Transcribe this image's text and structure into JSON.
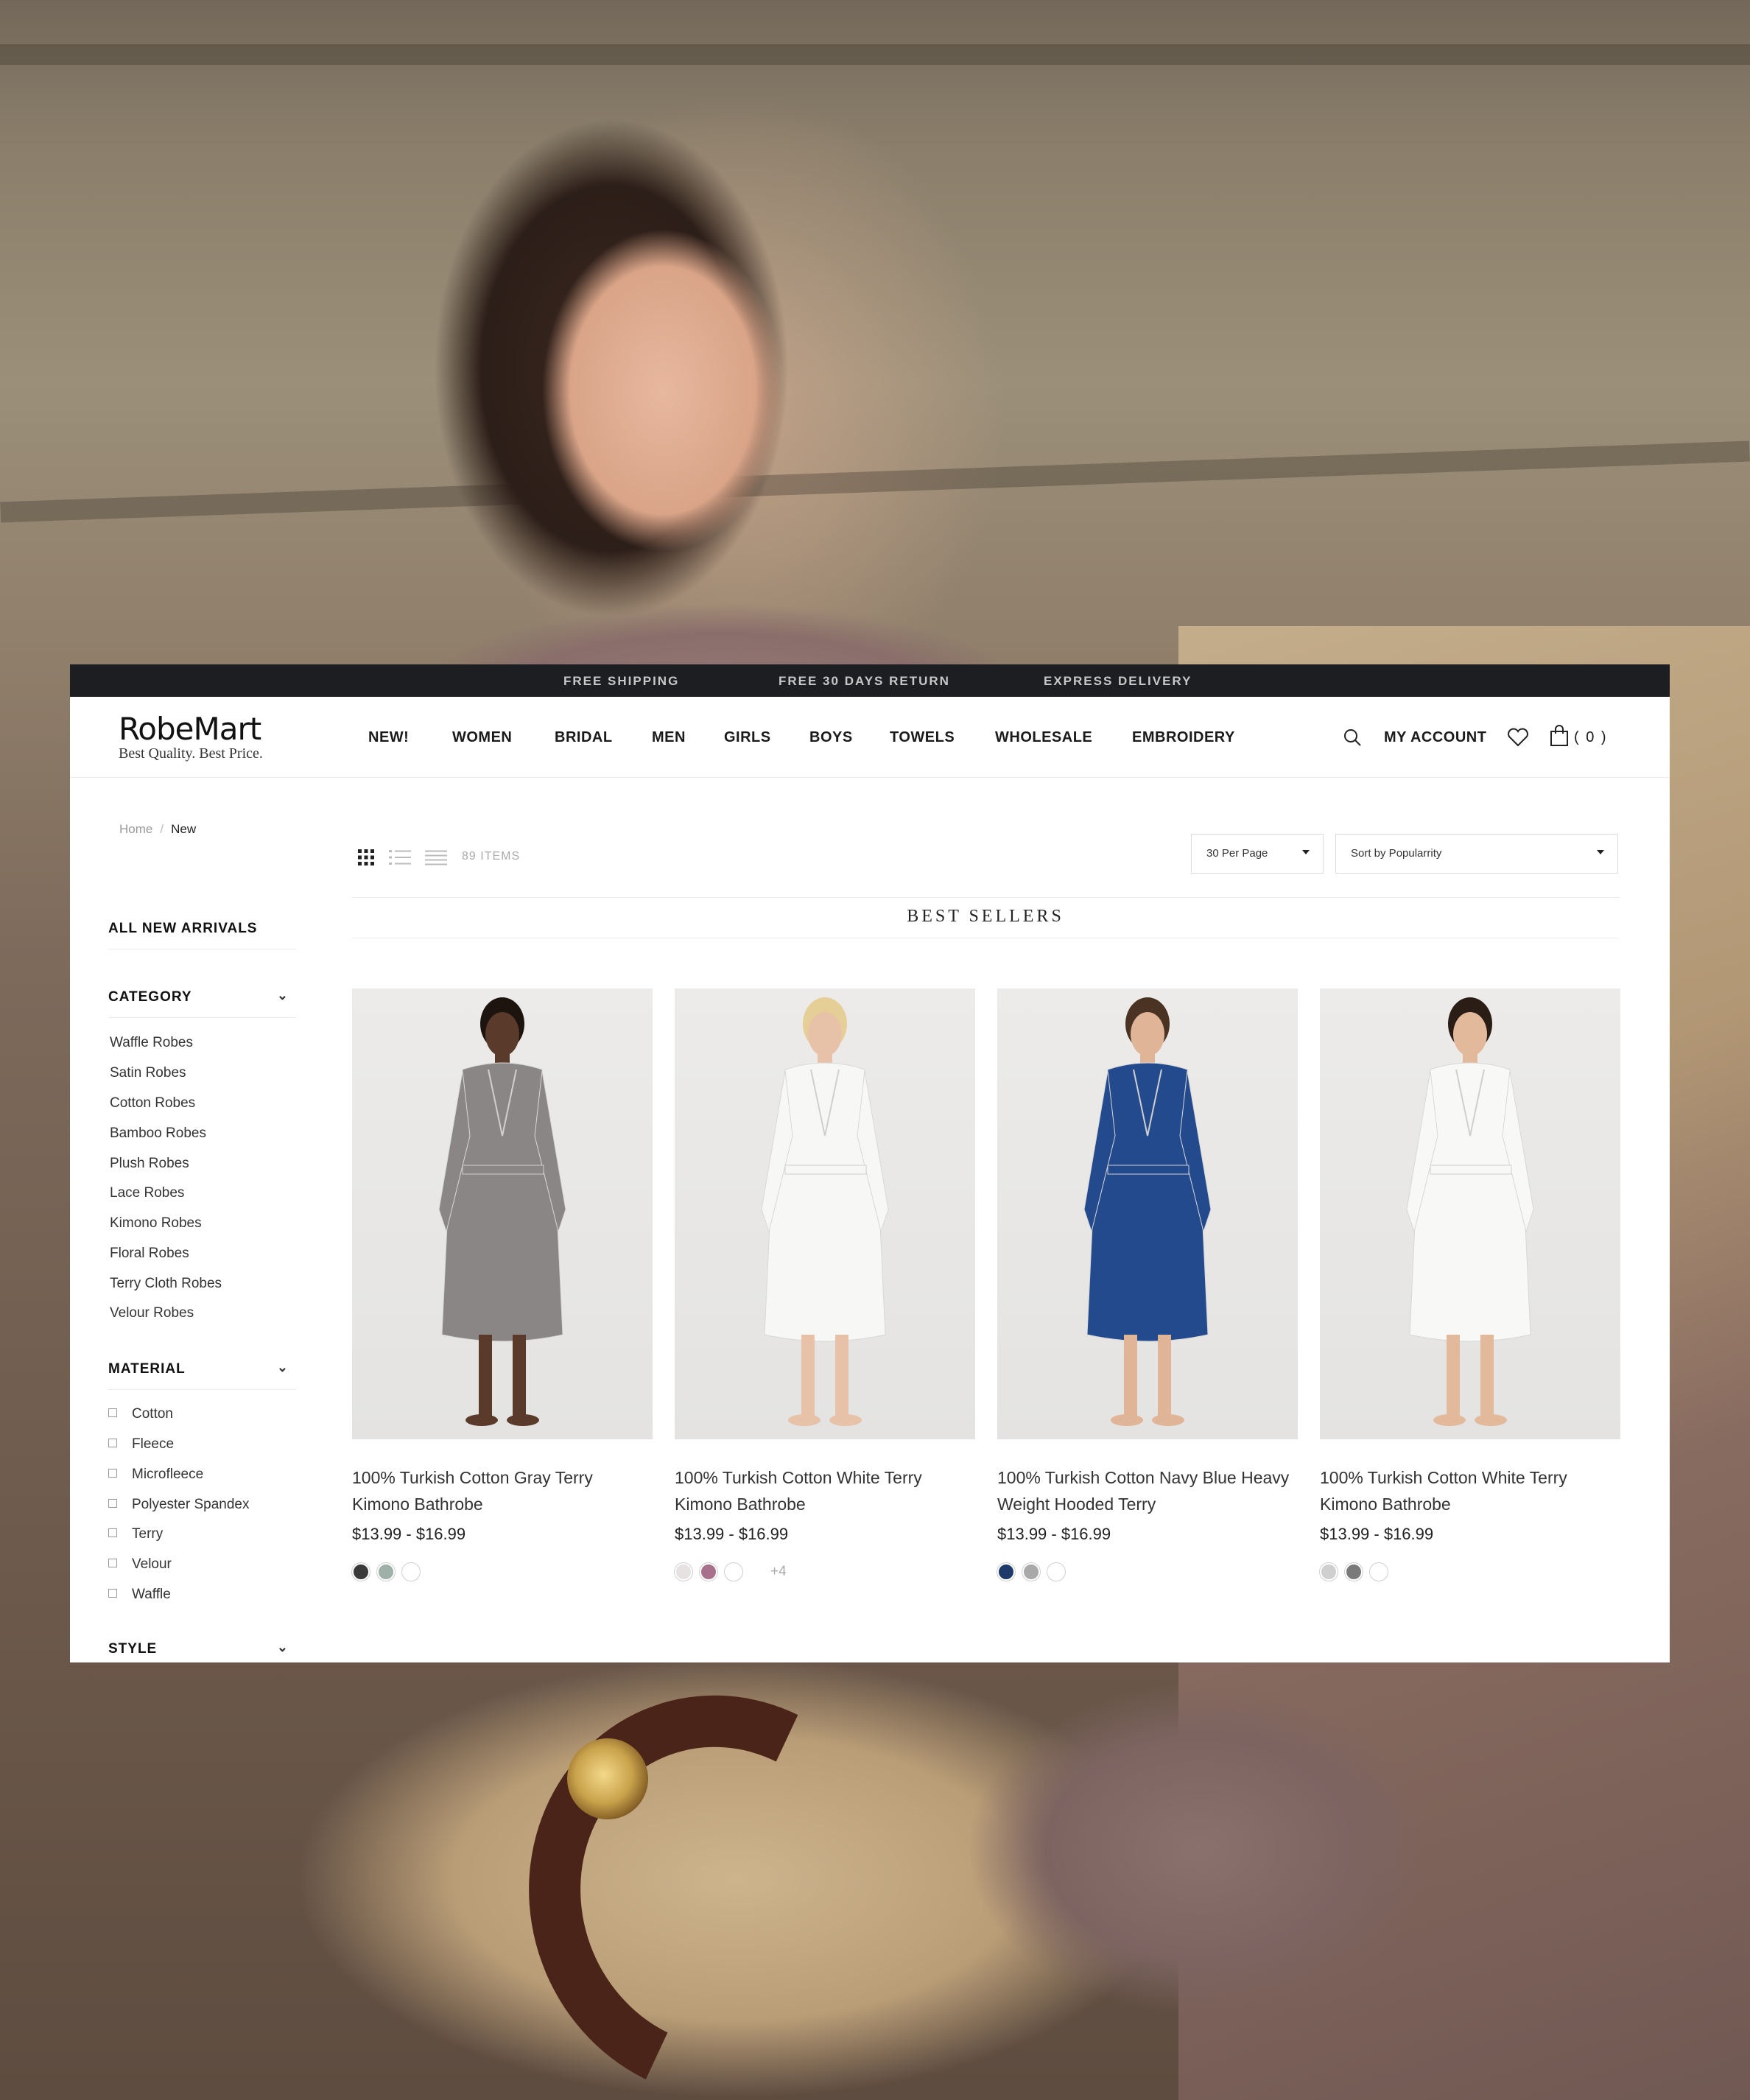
{
  "promo": {
    "items": [
      "FREE SHIPPING",
      "FREE 30 DAYS RETURN",
      "EXPRESS DELIVERY"
    ]
  },
  "brand": {
    "name": "RobeMart",
    "tagline": "Best Quality. Best Price."
  },
  "nav": {
    "items": [
      "NEW!",
      "WOMEN",
      "BRIDAL",
      "MEN",
      "GIRLS",
      "BOYS",
      "TOWELS",
      "WHOLESALE",
      "EMBROIDERY"
    ]
  },
  "header": {
    "account_label": "MY ACCOUNT",
    "cart_count": "( 0 )",
    "icons": [
      "search-icon",
      "heart-icon",
      "shopping-bag-icon"
    ]
  },
  "breadcrumb": {
    "home": "Home",
    "separator": "/",
    "current": "New"
  },
  "sidebar": {
    "all_new_arrivals": "ALL NEW ARRIVALS",
    "category_heading": "CATEGORY",
    "categories": [
      "Waffle Robes",
      "Satin Robes",
      "Cotton Robes",
      "Bamboo Robes",
      "Plush Robes",
      "Lace Robes",
      "Kimono Robes",
      "Floral Robes",
      "Terry Cloth Robes",
      "Velour Robes"
    ],
    "material_heading": "MATERIAL",
    "materials": [
      "Cotton",
      "Fleece",
      "Microfleece",
      "Polyester Spandex",
      "Terry",
      "Velour",
      "Waffle"
    ],
    "style_heading": "STYLE",
    "chevron": "⌄"
  },
  "toolbar": {
    "items_count": "89 ITEMS",
    "per_page": "30 Per Page",
    "sort": "Sort by Popularrity",
    "view_modes": [
      "grid-view-icon",
      "list-view-icon",
      "compact-list-icon"
    ]
  },
  "section": {
    "title": "BEST SELLERS"
  },
  "products": [
    {
      "title": "100% Turkish Cotton Gray Terry Kimono Bathrobe",
      "price": "$13.99 - $16.99",
      "swatches": [
        "#3a3a3a",
        "#9fb0a8",
        "#ffffff"
      ],
      "more": "",
      "robe_color": "#8a8686",
      "skin": "#5a3a2a",
      "hair": "#1d1410"
    },
    {
      "title": "100% Turkish Cotton White Terry Kimono Bathrobe",
      "price": "$13.99 - $16.99",
      "swatches": [
        "#e6e2e2",
        "#a8708a",
        "#ffffff"
      ],
      "more": "+4",
      "robe_color": "#f7f7f5",
      "skin": "#e8c2a8",
      "hair": "#e6cf96"
    },
    {
      "title": "100% Turkish Cotton Navy Blue Heavy Weight Hooded Terry",
      "price": "$13.99 - $16.99",
      "swatches": [
        "#1d3a6b",
        "#a9a9a9",
        "#ffffff"
      ],
      "more": "",
      "robe_color": "#234a8c",
      "skin": "#e0b496",
      "hair": "#4a3322"
    },
    {
      "title": "100% Turkish Cotton White Terry Kimono Bathrobe",
      "price": "$13.99 - $16.99",
      "swatches": [
        "#cfcfcf",
        "#7a7a7a",
        "#ffffff"
      ],
      "more": "",
      "robe_color": "#f8f8f6",
      "skin": "#e3b99b",
      "hair": "#2a1d16"
    }
  ]
}
